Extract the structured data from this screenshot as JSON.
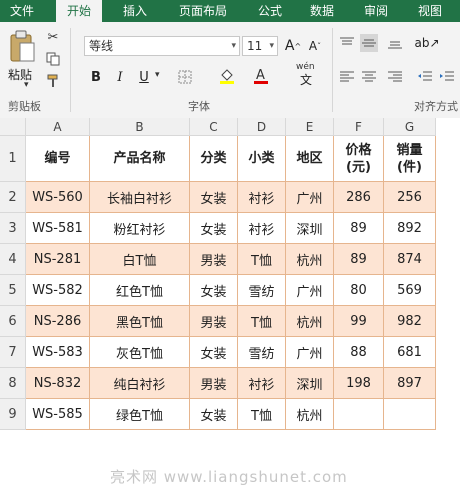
{
  "tabs": [
    "文件",
    "开始",
    "插入",
    "页面布局",
    "公式",
    "数据",
    "审阅",
    "视图"
  ],
  "ribbon": {
    "clipboard": {
      "paste_label": "粘贴",
      "group_label": "剪贴板"
    },
    "font": {
      "font_name": "等线",
      "font_size": "11",
      "bold": "B",
      "italic": "I",
      "underline": "U",
      "wen_label": "wén",
      "group_label": "字体"
    },
    "alignment": {
      "group_label": "对齐方式"
    }
  },
  "columns": [
    "A",
    "B",
    "C",
    "D",
    "E",
    "F",
    "G"
  ],
  "row_numbers": [
    "1",
    "2",
    "3",
    "4",
    "5",
    "6",
    "7",
    "8",
    "9"
  ],
  "table": {
    "headers": [
      "编号",
      "产品名称",
      "分类",
      "小类",
      "地区",
      "价格\n(元)",
      "销量\n(件)"
    ],
    "rows": [
      [
        "WS-560",
        "长袖白衬衫",
        "女装",
        "衬衫",
        "广州",
        "286",
        "256"
      ],
      [
        "WS-581",
        "粉红衬衫",
        "女装",
        "衬衫",
        "深圳",
        "89",
        "892"
      ],
      [
        "NS-281",
        "白T恤",
        "男装",
        "T恤",
        "杭州",
        "89",
        "874"
      ],
      [
        "WS-582",
        "红色T恤",
        "女装",
        "雪纺",
        "广州",
        "80",
        "569"
      ],
      [
        "NS-286",
        "黑色T恤",
        "男装",
        "T恤",
        "杭州",
        "99",
        "982"
      ],
      [
        "WS-583",
        "灰色T恤",
        "女装",
        "雪纺",
        "广州",
        "88",
        "681"
      ],
      [
        "NS-832",
        "纯白衬衫",
        "男装",
        "衬衫",
        "深圳",
        "198",
        "897"
      ],
      [
        "WS-585",
        "绿色T恤",
        "女装",
        "T恤",
        "杭州",
        "",
        ""
      ]
    ]
  },
  "watermark": "亮术网 www.liangshunet.com",
  "colors": {
    "ribbon_green": "#217346",
    "stripe": "#fde4d3",
    "border": "#e6b58e"
  }
}
